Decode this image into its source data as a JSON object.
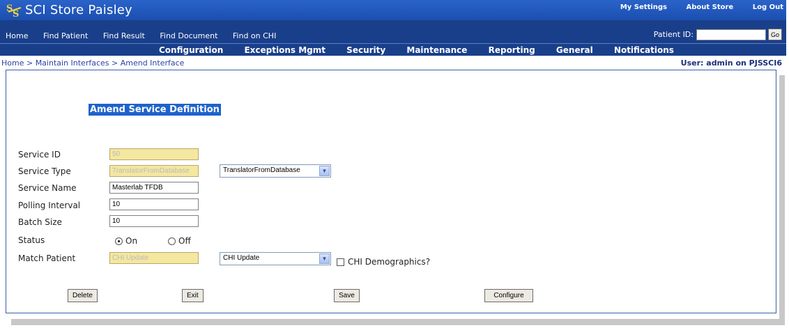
{
  "app": {
    "title": "SCI Store Paisley"
  },
  "toplinks": [
    "My Settings",
    "About Store",
    "Log Out"
  ],
  "nav": [
    "Home",
    "Find Patient",
    "Find Result",
    "Find Document",
    "Find on CHI"
  ],
  "patient_search": {
    "label": "Patient ID:",
    "value": "",
    "button": "Go"
  },
  "menu": [
    "Configuration",
    "Exceptions Mgmt",
    "Security",
    "Maintenance",
    "Reporting",
    "General",
    "Notifications"
  ],
  "breadcrumb": "Home > Maintain Interfaces > Amend Interface",
  "user": "User: admin on PJSSCI6",
  "form": {
    "title": "Amend Service Definition",
    "service_id": {
      "label": "Service ID",
      "value": "50"
    },
    "service_type": {
      "label": "Service Type",
      "value": "TranslatorFromDatabase",
      "selected": "TranslatorFromDatabase"
    },
    "service_name": {
      "label": "Service Name",
      "value": "Masterlab TFDB"
    },
    "polling_interval": {
      "label": "Polling Interval",
      "value": "10"
    },
    "batch_size": {
      "label": "Batch Size",
      "value": "10"
    },
    "status": {
      "label": "Status",
      "on": "On",
      "off": "Off",
      "selected": "On"
    },
    "match_patient": {
      "label": "Match Patient",
      "value": "CHI Update",
      "selected": "CHI Update"
    },
    "chi_demographics": {
      "label": "CHI Demographics?",
      "checked": false
    }
  },
  "buttons": {
    "delete": "Delete",
    "exit": "Exit",
    "save": "Save",
    "configure": "Configure"
  },
  "colors": {
    "header": "#2a63c9",
    "nav": "#1a3f8a",
    "accent": "#1e62cc",
    "readonly": "#f4e7a0"
  }
}
